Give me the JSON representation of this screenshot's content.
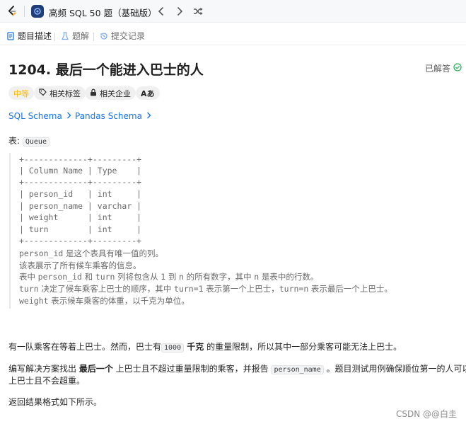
{
  "topbar": {
    "list_title": "高频 SQL 50 题（基础版）"
  },
  "tabs": [
    {
      "label": "题目描述",
      "icon": "document-icon"
    },
    {
      "label": "题解",
      "icon": "flask-icon"
    },
    {
      "label": "提交记录",
      "icon": "history-icon"
    }
  ],
  "problem": {
    "title": "1204. 最后一个能进入巴士的人",
    "status": "已解答",
    "difficulty": "中等",
    "tags_label": "相关标签",
    "companies_label": "相关企业",
    "font_label": "Aあ",
    "schema_links": [
      "SQL Schema",
      "Pandas Schema"
    ]
  },
  "table_intro": {
    "prefix": "表: ",
    "name": "Queue"
  },
  "schema_lines": [
    "+-------------+---------+",
    "| Column Name | Type    |",
    "+-------------+---------+",
    "| person_id   | int     |",
    "| person_name | varchar |",
    "| weight      | int     |",
    "| turn        | int     |",
    "+-------------+---------+"
  ],
  "notes": {
    "n1_code": "person_id",
    "n1_text": " 是这个表具有唯一值的列。",
    "n2": "该表展示了所有候车乘客的信息。",
    "n3_a": "表中 ",
    "n3_b": "person_id",
    "n3_c": " 和 ",
    "n3_d": "turn",
    "n3_e": " 列将包含从 ",
    "n3_f": "1",
    "n3_g": " 到 ",
    "n3_h": "n",
    "n3_i": " 的所有数字，其中 ",
    "n3_j": "n",
    "n3_k": " 是表中的行数。",
    "n4_a": "turn",
    "n4_b": " 决定了候车乘客上巴士的顺序，其中 ",
    "n4_c": "turn=1",
    "n4_d": " 表示第一个上巴士，",
    "n4_e": "turn=n",
    "n4_f": " 表示最后一个上巴士。",
    "n5_a": "weight",
    "n5_b": " 表示候车乘客的体重，以千克为单位。"
  },
  "description": {
    "p1_a": "有一队乘客在等着上巴士。然而，巴士有",
    "p1_code": "1000",
    "p1_bold": " 千克",
    "p1_b": " 的重量限制，所以其中一部分乘客可能无法上巴士。",
    "p2_a": "编写解决方案找出 ",
    "p2_bold": "最后一个",
    "p2_b": " 上巴士且不超过重量限制的乘客，并报告 ",
    "p2_code": "person_name",
    "p2_c": " 。题目测试用例确保顺位第一的人可以",
    "p2_line2": "上巴士且不会超重。",
    "p3": "返回结果格式如下所示。"
  },
  "watermark": "CSDN @@白圭",
  "colors": {
    "difficulty": "#ffb800",
    "link": "#1a73e8",
    "solved_check": "#2db55d",
    "list_icon_bg": "#1f3d77"
  }
}
